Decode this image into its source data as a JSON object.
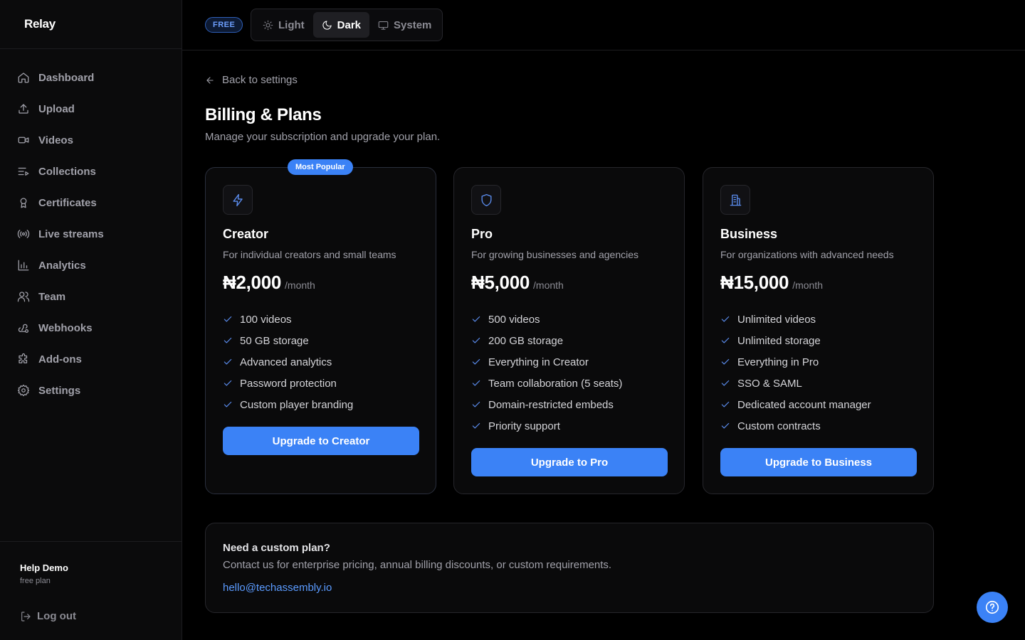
{
  "app": {
    "brand": "Relay"
  },
  "sidebar": {
    "items": [
      {
        "label": "Dashboard",
        "icon": "home-icon"
      },
      {
        "label": "Upload",
        "icon": "upload-icon"
      },
      {
        "label": "Videos",
        "icon": "video-icon"
      },
      {
        "label": "Collections",
        "icon": "list-play-icon"
      },
      {
        "label": "Certificates",
        "icon": "award-icon"
      },
      {
        "label": "Live streams",
        "icon": "radio-icon"
      },
      {
        "label": "Analytics",
        "icon": "bar-chart-icon"
      },
      {
        "label": "Team",
        "icon": "users-icon"
      },
      {
        "label": "Webhooks",
        "icon": "webhook-icon"
      },
      {
        "label": "Add-ons",
        "icon": "puzzle-icon"
      },
      {
        "label": "Settings",
        "icon": "gear-icon"
      }
    ],
    "user": {
      "name": "Help Demo",
      "plan": "free plan"
    },
    "logout_label": "Log out"
  },
  "topbar": {
    "badge": "FREE",
    "theme": {
      "light": "Light",
      "dark": "Dark",
      "system": "System",
      "selected": "Dark"
    }
  },
  "page": {
    "back_label": "Back to settings",
    "title": "Billing & Plans",
    "subtitle": "Manage your subscription and upgrade your plan."
  },
  "plans": [
    {
      "name": "Creator",
      "badge": "Most Popular",
      "icon": "lightning-icon",
      "description": "For individual creators and small teams",
      "price": "₦2,000",
      "period": "/month",
      "features": [
        "100 videos",
        "50 GB storage",
        "Advanced analytics",
        "Password protection",
        "Custom player branding"
      ],
      "button": "Upgrade to Creator"
    },
    {
      "name": "Pro",
      "icon": "shield-icon",
      "description": "For growing businesses and agencies",
      "price": "₦5,000",
      "period": "/month",
      "features": [
        "500 videos",
        "200 GB storage",
        "Everything in Creator",
        "Team collaboration (5 seats)",
        "Domain-restricted embeds",
        "Priority support"
      ],
      "button": "Upgrade to Pro"
    },
    {
      "name": "Business",
      "icon": "building-icon",
      "description": "For organizations with advanced needs",
      "price": "₦15,000",
      "period": "/month",
      "features": [
        "Unlimited videos",
        "Unlimited storage",
        "Everything in Pro",
        "SSO & SAML",
        "Dedicated account manager",
        "Custom contracts"
      ],
      "button": "Upgrade to Business"
    }
  ],
  "custom_plan": {
    "title": "Need a custom plan?",
    "text": "Contact us for enterprise pricing, annual billing discounts, or custom requirements.",
    "email": "hello@techassembly.io"
  },
  "colors": {
    "accent": "#3b82f6",
    "background": "#000000",
    "sidebar": "#0b0b0c"
  }
}
